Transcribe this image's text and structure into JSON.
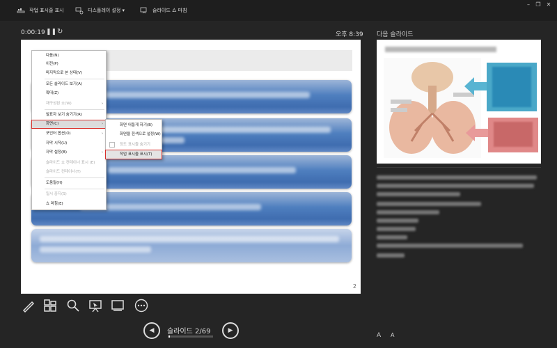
{
  "toolbar": {
    "show_taskbar": "작업 표시줄 표시",
    "display_settings": "디스플레이 설정 ▾",
    "end_show": "슬라이드 쇼 마침"
  },
  "window_controls": {
    "minimize": "–",
    "restore": "❐",
    "close": "✕"
  },
  "presenter": {
    "timer": "0:00:19",
    "clock": "오후 8:39",
    "next_slide_label": "다음 슬라이드"
  },
  "slide": {
    "number": "2"
  },
  "context_menu": {
    "items": [
      {
        "label": "다음(N)",
        "enabled": true
      },
      {
        "label": "이전(P)",
        "enabled": true
      },
      {
        "label": "마지막으로 본 상태(V)",
        "enabled": true
      },
      {
        "label": "모든 슬라이드 보기(A)",
        "enabled": true
      },
      {
        "label": "확대(Z)",
        "enabled": true
      },
      {
        "label": "재구성된 쇼(W)",
        "enabled": false
      },
      {
        "label": "발표자 보기 숨기기(R)",
        "enabled": true
      },
      {
        "label": "화면(C)",
        "enabled": true
      },
      {
        "label": "포인터 옵션(O)",
        "enabled": true
      },
      {
        "label": "자막 시작(U)",
        "enabled": true
      },
      {
        "label": "자막 설정(B)",
        "enabled": true
      },
      {
        "label": "슬라이드 쇼 컨테이너 표시 (E)",
        "enabled": false
      },
      {
        "label": "슬라이드 컨테이너(T)",
        "enabled": false
      },
      {
        "label": "도움말(H)",
        "enabled": true
      },
      {
        "label": "일시 중지(S)",
        "enabled": false
      },
      {
        "label": "쇼 마침(E)",
        "enabled": true
      }
    ]
  },
  "submenu": {
    "items": [
      {
        "label": "화면 어둡게 하기(B)",
        "enabled": true
      },
      {
        "label": "화면을 흰색으로 설정(W)",
        "enabled": true
      },
      {
        "label": "정도 표시줄 숨기기",
        "enabled": false
      },
      {
        "label": "작업 표시줄 표시(T)",
        "enabled": true
      }
    ]
  },
  "tools": {
    "pen": "pen-icon",
    "see_all_slides": "grid-icon",
    "zoom": "magnifier-icon",
    "pointer": "pointer-icon",
    "black_screen": "screen-icon",
    "more": "more-icon"
  },
  "navigation": {
    "prev": "◀",
    "next": "▶",
    "counter": "슬라이드 2/69",
    "progress": 0.029
  },
  "notes_controls": {
    "increase": "A",
    "decrease": "A"
  }
}
